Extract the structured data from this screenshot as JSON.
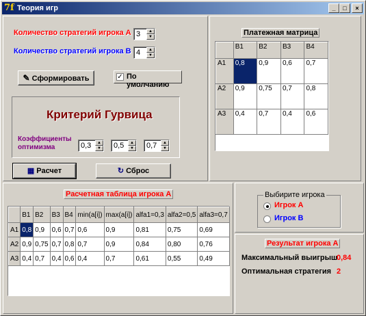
{
  "window": {
    "title": "Теория игр",
    "app_icon": "7f",
    "minimize": "_",
    "maximize": "□",
    "close": "×"
  },
  "settings": {
    "strat_a_label": "Количество стратегий игрока А",
    "strat_a_value": "3",
    "strat_b_label": "Количество стратегий игрока В",
    "strat_b_value": "4",
    "form_button": "Сформировать",
    "default_checkbox": "По умолчанию",
    "default_checked": true
  },
  "criterion": {
    "title": "Критерий Гурвица",
    "coef_label_line1": "Коэффициенты",
    "coef_label_line2": "оптимизма",
    "coef1": "0,3",
    "coef2": "0,5",
    "coef3": "0,7"
  },
  "actions": {
    "calc_button": "Расчет",
    "reset_button": "Сброс"
  },
  "payoff": {
    "title": "Платежная матрица",
    "columns": [
      "B1",
      "B2",
      "B3",
      "B4"
    ],
    "rows": [
      {
        "label": "A1",
        "cells": [
          "0,8",
          "0,9",
          "0,6",
          "0,7"
        ]
      },
      {
        "label": "A2",
        "cells": [
          "0,9",
          "0,75",
          "0,7",
          "0,8"
        ]
      },
      {
        "label": "A3",
        "cells": [
          "0,4",
          "0,7",
          "0,4",
          "0,6"
        ]
      }
    ]
  },
  "calc_table": {
    "title": "Расчетная таблица игрока А",
    "columns": [
      "B1",
      "B2",
      "B3",
      "B4",
      "min(a[i])",
      "max(a[i])",
      "alfa1=0,3",
      "alfa2=0,5",
      "alfa3=0,7"
    ],
    "rows": [
      {
        "label": "A1",
        "cells": [
          "0,8",
          "0,9",
          "0,6",
          "0,7",
          "0,6",
          "0,9",
          "0,81",
          "0,75",
          "0,69"
        ]
      },
      {
        "label": "A2",
        "cells": [
          "0,9",
          "0,75",
          "0,7",
          "0,8",
          "0,7",
          "0,9",
          "0,84",
          "0,80",
          "0,76"
        ]
      },
      {
        "label": "A3",
        "cells": [
          "0,4",
          "0,7",
          "0,4",
          "0,6",
          "0,4",
          "0,7",
          "0,61",
          "0,55",
          "0,49"
        ]
      }
    ]
  },
  "player_select": {
    "caption": "Выбирите игрока",
    "option_a": "Игрок А",
    "option_b": "Игрок В",
    "selected": "A"
  },
  "result": {
    "title": "Результат игрока А",
    "max_win_label": "Максимальный выигрыш",
    "max_win_value": "0,84",
    "opt_strategy_label": "Оптимальная стратегия",
    "opt_strategy_value": "2"
  }
}
